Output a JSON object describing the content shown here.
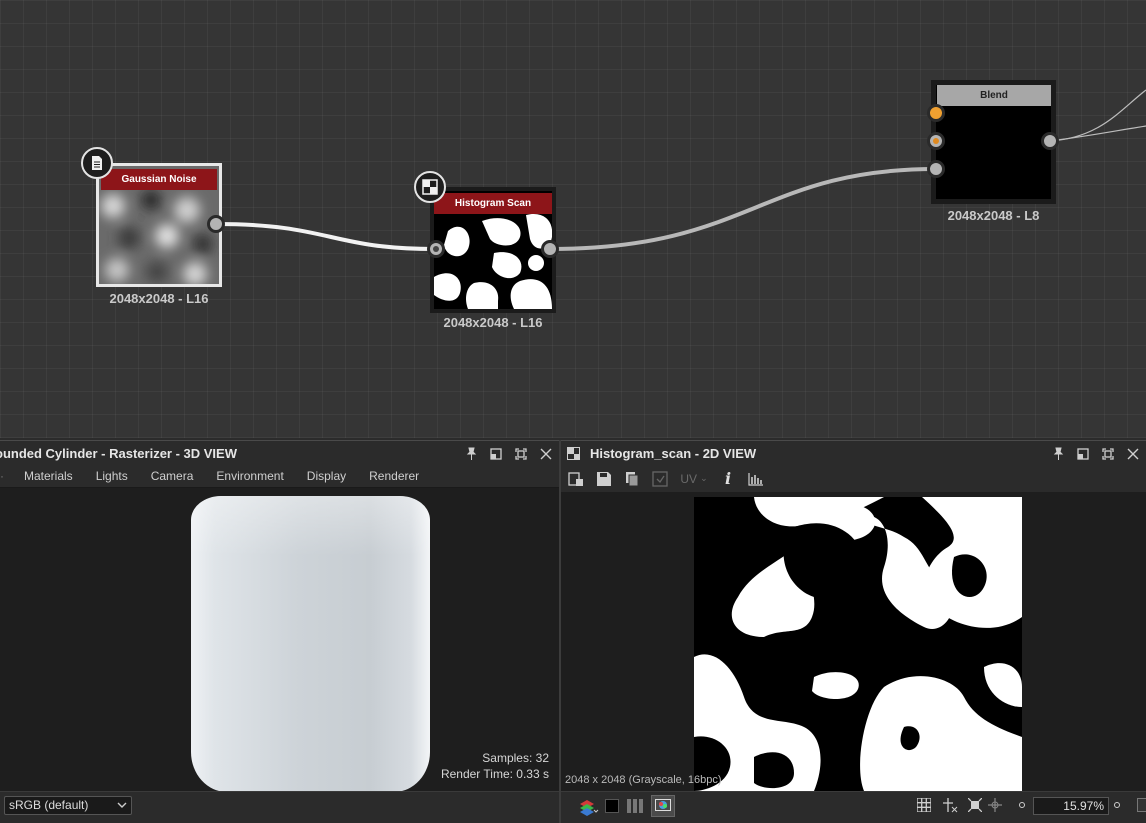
{
  "graph": {
    "nodes": {
      "gaussian": {
        "title": "Gaussian Noise",
        "resolution": "2048x2048 - L16",
        "badge_icon": "document-icon"
      },
      "histogram": {
        "title": "Histogram Scan",
        "resolution": "2048x2048 - L16",
        "badge_icon": "checker-icon"
      },
      "blend": {
        "title": "Blend",
        "resolution": "2048x2048 - L8"
      }
    }
  },
  "panel3d": {
    "title": "ounded Cylinder - Rasterizer - 3D VIEW",
    "menu": [
      "Materials",
      "Lights",
      "Camera",
      "Environment",
      "Display",
      "Renderer"
    ],
    "samples": "Samples: 32",
    "render_time": "Render Time: 0.33 s",
    "colorspace": "sRGB (default)"
  },
  "panel2d": {
    "title": "Histogram_scan - 2D VIEW",
    "uv_label": "UV",
    "image_info": "2048 x 2048 (Grayscale, 16bpc)",
    "zoom": "15.97%"
  },
  "colors": {
    "title_bar": "#8d1519",
    "blend_title": "#a7a7a7",
    "wire": "#f2f2f2"
  }
}
